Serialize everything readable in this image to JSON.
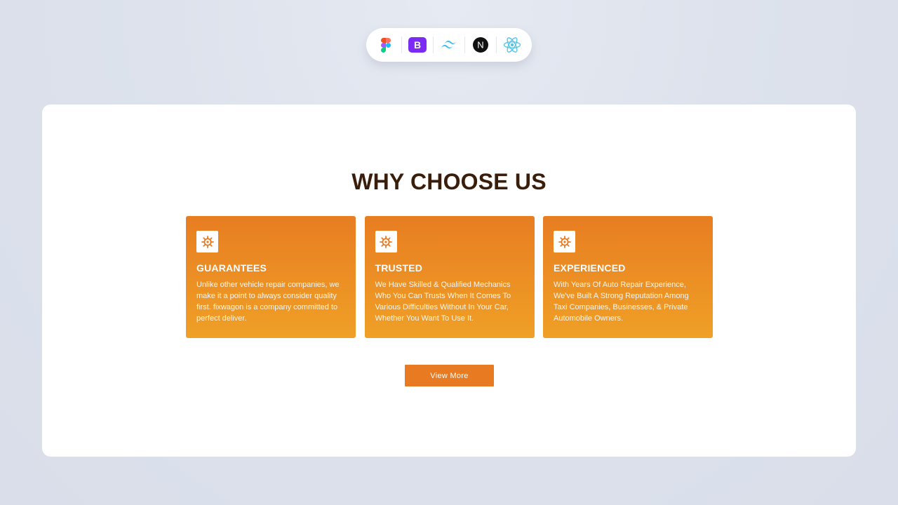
{
  "techbar": {
    "icons": [
      "figma-icon",
      "bootstrap-icon",
      "tailwind-icon",
      "nextjs-icon",
      "react-icon"
    ],
    "bootstrap_letter": "B",
    "next_letter": "N"
  },
  "section": {
    "title": "WHY CHOOSE US"
  },
  "cards": [
    {
      "icon": "gear-icon",
      "title": "GUARANTEES",
      "description": "Unlike other vehicle repair companies, we make it a point to always consider quality first. fixwagon is a company committed to perfect deliver."
    },
    {
      "icon": "gear-icon",
      "title": "TRUSTED",
      "description": "We Have Skilled & Qualified Mechanics Who You Can Trusts When It Comes To Various Difficulties Without In Your Car, Whether You Want To Use It."
    },
    {
      "icon": "gear-icon",
      "title": "EXPERIENCED",
      "description": "With Years Of Auto Repair Experience, We've Built A Strong Reputation Among Taxi Companies, Businesses, & Private Automobile Owners."
    }
  ],
  "cta": {
    "label": "View More"
  },
  "colors": {
    "title": "#3a1e0c",
    "card_top": "#e87d22",
    "card_bottom": "#efa026",
    "button": "#e87b22"
  }
}
